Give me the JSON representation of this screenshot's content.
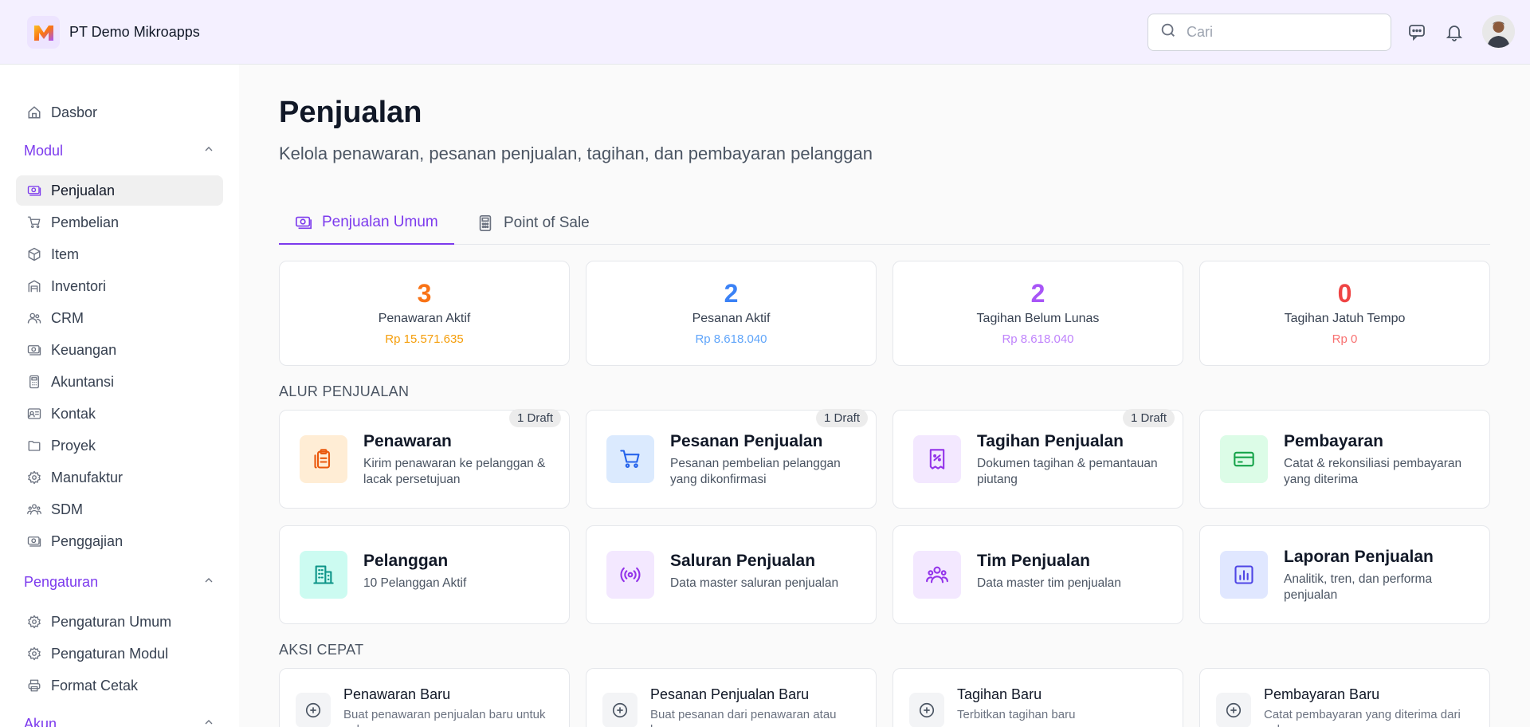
{
  "header": {
    "company": "PT Demo Mikroapps",
    "search_placeholder": "Cari"
  },
  "sidebar": {
    "dashboard": "Dasbor",
    "modul_title": "Modul",
    "modul_items": [
      {
        "label": "Penjualan",
        "icon": "money-icon"
      },
      {
        "label": "Pembelian",
        "icon": "cart-icon"
      },
      {
        "label": "Item",
        "icon": "box-icon"
      },
      {
        "label": "Inventori",
        "icon": "warehouse-icon"
      },
      {
        "label": "CRM",
        "icon": "users-icon"
      },
      {
        "label": "Keuangan",
        "icon": "money-icon"
      },
      {
        "label": "Akuntansi",
        "icon": "calculator-icon"
      },
      {
        "label": "Kontak",
        "icon": "contact-card-icon"
      },
      {
        "label": "Proyek",
        "icon": "folder-icon"
      },
      {
        "label": "Manufaktur",
        "icon": "gear-icon"
      },
      {
        "label": "SDM",
        "icon": "group-icon"
      },
      {
        "label": "Penggajian",
        "icon": "money-icon"
      }
    ],
    "pengaturan_title": "Pengaturan",
    "pengaturan_items": [
      {
        "label": "Pengaturan Umum",
        "icon": "gear-icon"
      },
      {
        "label": "Pengaturan Modul",
        "icon": "gear-icon"
      },
      {
        "label": "Format Cetak",
        "icon": "printer-icon"
      }
    ],
    "akun_title": "Akun"
  },
  "page": {
    "title": "Penjualan",
    "subtitle": "Kelola penawaran, pesanan penjualan, tagihan, dan pembayaran pelanggan"
  },
  "tabs": [
    "Penjualan Umum",
    "Point of Sale"
  ],
  "stats": [
    {
      "value": "3",
      "label": "Penawaran Aktif",
      "amount": "Rp 15.571.635",
      "color": "#f97316",
      "amount_color": "#f59e0b"
    },
    {
      "value": "2",
      "label": "Pesanan Aktif",
      "amount": "Rp 8.618.040",
      "color": "#3b82f6",
      "amount_color": "#60a5fa"
    },
    {
      "value": "2",
      "label": "Tagihan Belum Lunas",
      "amount": "Rp 8.618.040",
      "color": "#a855f7",
      "amount_color": "#c084fc"
    },
    {
      "value": "0",
      "label": "Tagihan Jatuh Tempo",
      "amount": "Rp 0",
      "color": "#ef4444",
      "amount_color": "#f87171"
    }
  ],
  "flow_title": "ALUR PENJUALAN",
  "flow_cards": [
    {
      "title": "Penawaran",
      "desc": "Kirim penawaran ke pelanggan & lacak persetujuan",
      "badge": "1 Draft",
      "icon": "clipboard-icon"
    },
    {
      "title": "Pesanan Penjualan",
      "desc": "Pesanan pembelian pelanggan yang dikonfirmasi",
      "badge": "1 Draft",
      "icon": "cart-icon"
    },
    {
      "title": "Tagihan Penjualan",
      "desc": "Dokumen tagihan & pemantauan piutang",
      "badge": "1 Draft",
      "icon": "receipt-icon"
    },
    {
      "title": "Pembayaran",
      "desc": "Catat & rekonsiliasi pembayaran yang diterima",
      "badge": "",
      "icon": "credit-card-icon"
    },
    {
      "title": "Pelanggan",
      "desc": "10 Pelanggan Aktif",
      "badge": "",
      "icon": "building-icon"
    },
    {
      "title": "Saluran Penjualan",
      "desc": "Data master saluran penjualan",
      "badge": "",
      "icon": "broadcast-icon"
    },
    {
      "title": "Tim Penjualan",
      "desc": "Data master tim penjualan",
      "badge": "",
      "icon": "team-icon"
    },
    {
      "title": "Laporan Penjualan",
      "desc": "Analitik, tren, dan performa penjualan",
      "badge": "",
      "icon": "bar-chart-icon"
    }
  ],
  "quick_title": "AKSI CEPAT",
  "quick_actions": [
    {
      "title": "Penawaran Baru",
      "desc": "Buat penawaran penjualan baru untuk pelanggan"
    },
    {
      "title": "Pesanan Penjualan Baru",
      "desc": "Buat pesanan dari penawaran atau langsung"
    },
    {
      "title": "Tagihan Baru",
      "desc": "Terbitkan tagihan baru"
    },
    {
      "title": "Pembayaran Baru",
      "desc": "Catat pembayaran yang diterima dari pelanggan"
    }
  ]
}
